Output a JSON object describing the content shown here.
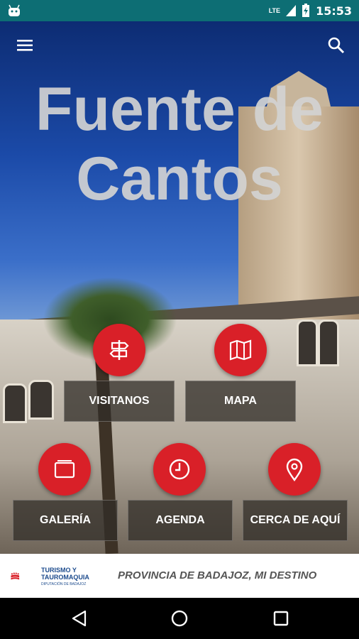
{
  "status_bar": {
    "time": "15:53",
    "network": "LTE"
  },
  "header": {
    "title": "Fuente de Cantos",
    "menu_icon": "hamburger-menu-icon",
    "search_icon": "search-icon"
  },
  "buttons": [
    {
      "label": "VISITANOS",
      "icon": "signpost-icon"
    },
    {
      "label": "MAPA",
      "icon": "map-icon"
    },
    {
      "label": "GALERÍA",
      "icon": "gallery-icon"
    },
    {
      "label": "AGENDA",
      "icon": "clock-icon"
    },
    {
      "label": "CERCA DE AQUÍ",
      "icon": "location-pin-icon"
    }
  ],
  "footer": {
    "logo_line1": "TURISMO Y",
    "logo_line2": "TAUROMAQUIA",
    "logo_sub": "DIPUTACIÓN DE BADAJOZ",
    "tagline": "PROVINCIA DE BADAJOZ, MI DESTINO"
  },
  "colors": {
    "accent": "#d92028",
    "status_bar": "#0d6e74",
    "logo_blue": "#1b4a8c"
  }
}
